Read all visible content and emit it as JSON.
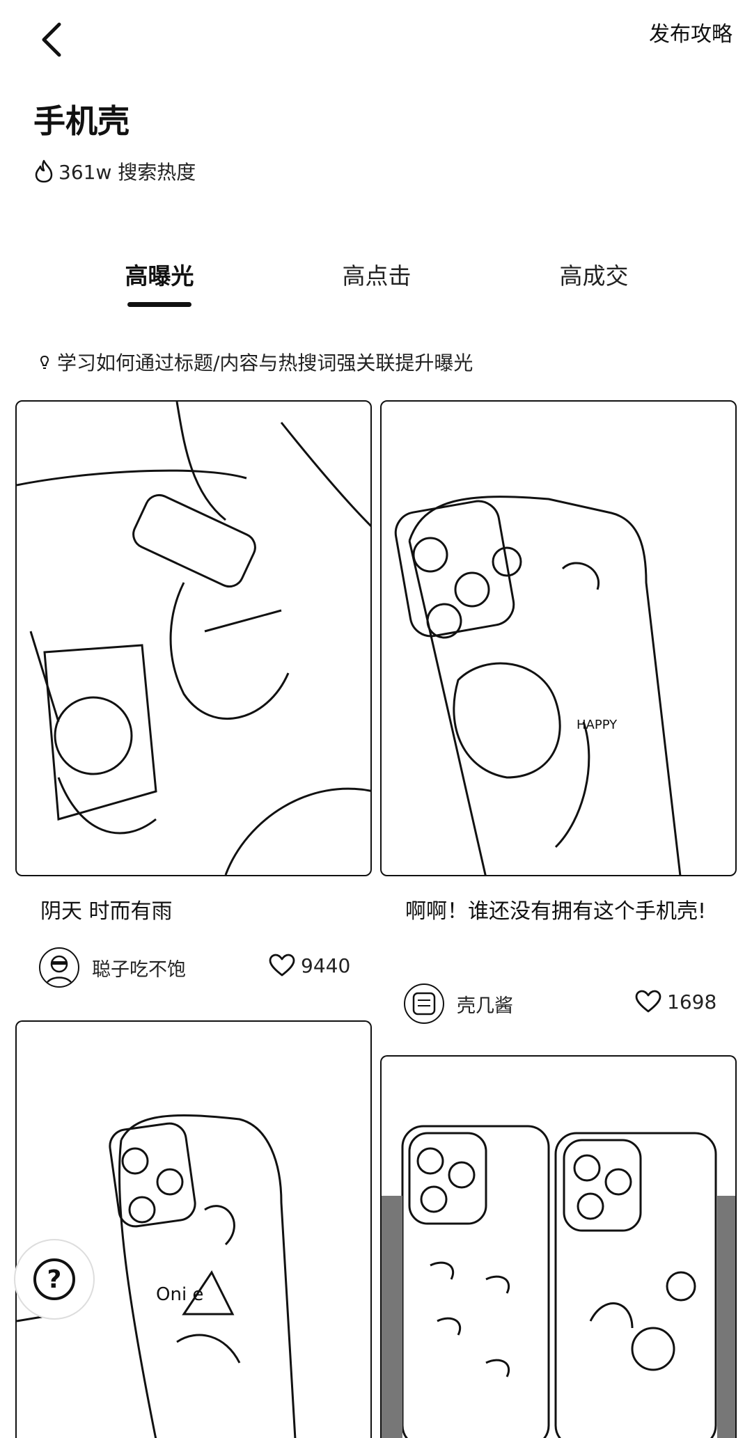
{
  "header": {
    "publish_label": "发布攻略"
  },
  "topic": {
    "title": "手机壳",
    "heat": "361w 搜索热度"
  },
  "tabs": [
    {
      "label": "高曝光",
      "active": true
    },
    {
      "label": "高点击",
      "active": false
    },
    {
      "label": "高成交",
      "active": false
    }
  ],
  "tip": "学习如何通过标题/内容与热搜词强关联提升曝光",
  "cards": [
    {
      "title": "阴天 时而有雨",
      "author": "聪子吃不饱",
      "likes": "9440"
    },
    {
      "title": "啊啊！谁还没有拥有这个手机壳!",
      "author": "壳几酱",
      "likes": "1698"
    },
    {
      "title": "",
      "author": "",
      "likes": ""
    },
    {
      "title": "",
      "author": "",
      "likes": ""
    }
  ],
  "icons": {
    "back": "chevron-left-icon",
    "heat": "flame-icon",
    "tip": "bulb-icon",
    "like": "heart-icon",
    "help": "question-icon"
  },
  "colors": {
    "text": "#111111",
    "background": "#ffffff",
    "active_tab_underline": "#111111"
  }
}
